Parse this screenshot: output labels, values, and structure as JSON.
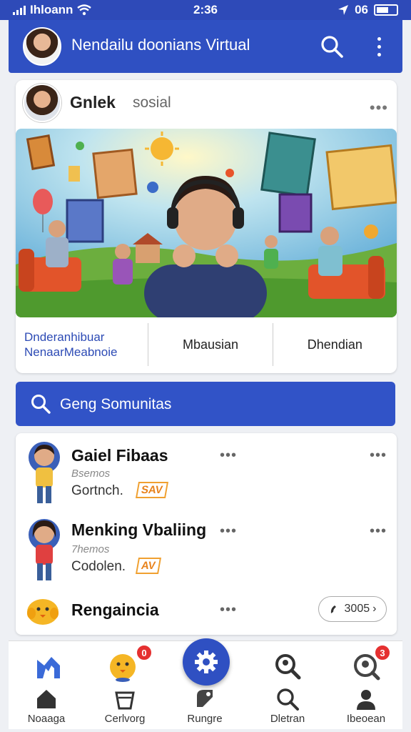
{
  "status_bar": {
    "carrier": "Ihloann",
    "time": "2:36",
    "signal_right": "06",
    "icons": [
      "signal-bars-icon",
      "wifi-icon",
      "location-arrow-icon",
      "battery-icon"
    ]
  },
  "header": {
    "title": "Nendailu doonians Virtual",
    "icons": [
      "profile-avatar",
      "search-icon",
      "more-vertical-icon"
    ]
  },
  "post": {
    "author": "Gnlek",
    "subtitle": "sosial",
    "image_alt": "",
    "actions": [
      {
        "label_line1": "Dnderanhibuar",
        "label_line2": "NenaarMeabnoie"
      },
      {
        "label": "Mbausian"
      },
      {
        "label": "Dhendian"
      }
    ]
  },
  "community_search": {
    "label": "Geng Somunitas",
    "icon": "search-icon"
  },
  "list": [
    {
      "name": "Gaiel Fibaas",
      "meta": "Bsemos",
      "detail": "Gortnch.",
      "badge": "SAV",
      "figure": "boy-yellow-shirt"
    },
    {
      "name": "Menking Vbaliing",
      "meta": "7hemos",
      "detail": "Codolen.",
      "badge": "AV",
      "figure": "girl-red-shirt"
    },
    {
      "name": "Rengaincia",
      "pill": "3005",
      "figure": "yellow-chick"
    }
  ],
  "bottom_nav": {
    "top_icons": [
      "home-m-icon",
      "chick-notification-icon",
      "gear-fab-icon",
      "search-people-icon",
      "chat-notification-icon"
    ],
    "badges": {
      "chick": "0",
      "chat": "3"
    },
    "items": [
      {
        "label": "Noaaga",
        "icon": "home-icon"
      },
      {
        "label": "Cerlvorg",
        "icon": "bucket-icon"
      },
      {
        "label": "Rungre",
        "icon": "tag-icon"
      },
      {
        "label": "Dletran",
        "icon": "search-icon"
      },
      {
        "label": "Ibeoean",
        "icon": "profile-icon"
      }
    ]
  },
  "colors": {
    "primary": "#2f50c2",
    "accent_orange": "#e8821c",
    "badge_red": "#e53030"
  }
}
